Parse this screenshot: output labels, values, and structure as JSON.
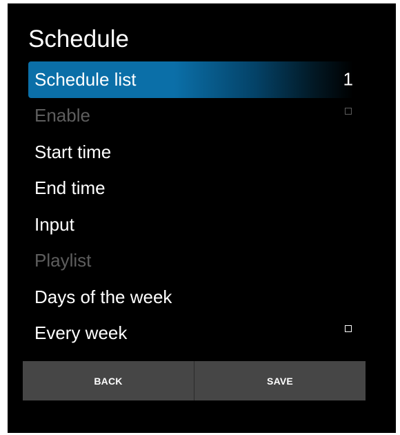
{
  "screen": {
    "title": "Schedule"
  },
  "menu": {
    "items": [
      {
        "label": "Schedule list",
        "value": "1"
      },
      {
        "label": "Enable"
      },
      {
        "label": "Start time"
      },
      {
        "label": "End time"
      },
      {
        "label": "Input"
      },
      {
        "label": "Playlist"
      },
      {
        "label": "Days of the week"
      },
      {
        "label": "Every week"
      }
    ]
  },
  "buttons": {
    "back_label": "BACK",
    "save_label": "SAVE"
  },
  "colors": {
    "accent": "#0b6fa8",
    "background": "#000000",
    "button_bg": "#464646",
    "disabled_text": "#5e5e5e"
  }
}
